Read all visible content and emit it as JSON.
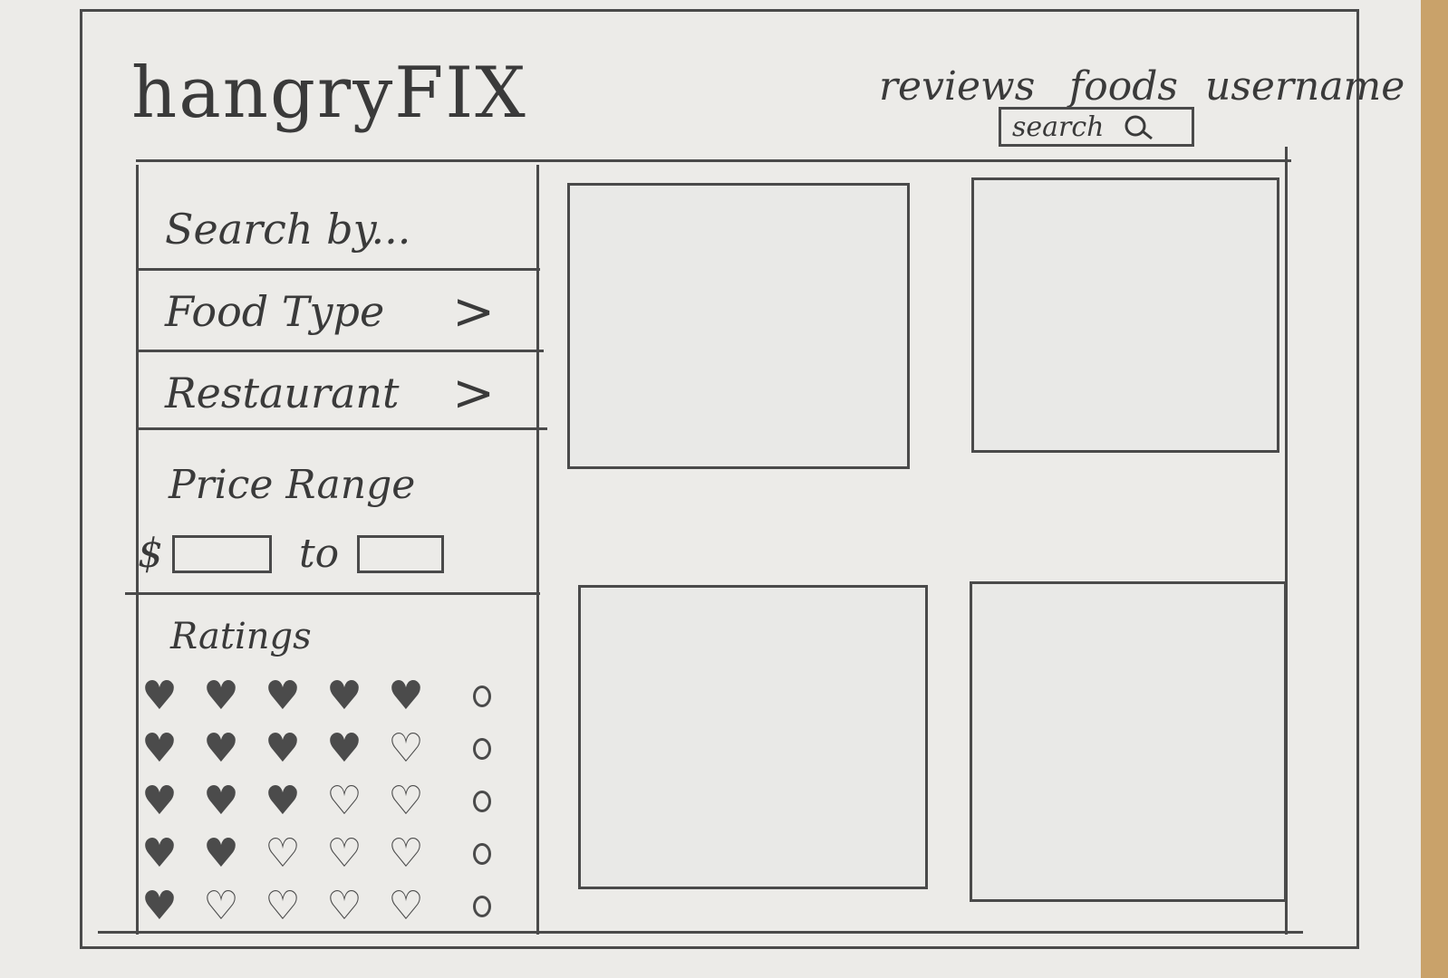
{
  "header": {
    "logo": "hangryFIX",
    "nav": {
      "reviews": "reviews",
      "foods": "foods",
      "username": "username"
    },
    "search": {
      "label": "search",
      "icon": "magnifier-icon"
    }
  },
  "sidebar": {
    "search_by": "Search by...",
    "food_type": "Food Type",
    "restaurant": "Restaurant",
    "chevron": ">",
    "price_range": {
      "label": "Price Range",
      "currency": "$",
      "to": "to",
      "min_value": "",
      "max_value": ""
    },
    "ratings": {
      "label": "Ratings",
      "rows": [
        {
          "filled": 5,
          "total": 5
        },
        {
          "filled": 4,
          "total": 5
        },
        {
          "filled": 3,
          "total": 5
        },
        {
          "filled": 2,
          "total": 5
        },
        {
          "filled": 1,
          "total": 5
        }
      ]
    }
  },
  "results": {
    "cards": [
      {
        "id": 1,
        "content": ""
      },
      {
        "id": 2,
        "content": ""
      },
      {
        "id": 3,
        "content": ""
      },
      {
        "id": 4,
        "content": ""
      }
    ]
  }
}
